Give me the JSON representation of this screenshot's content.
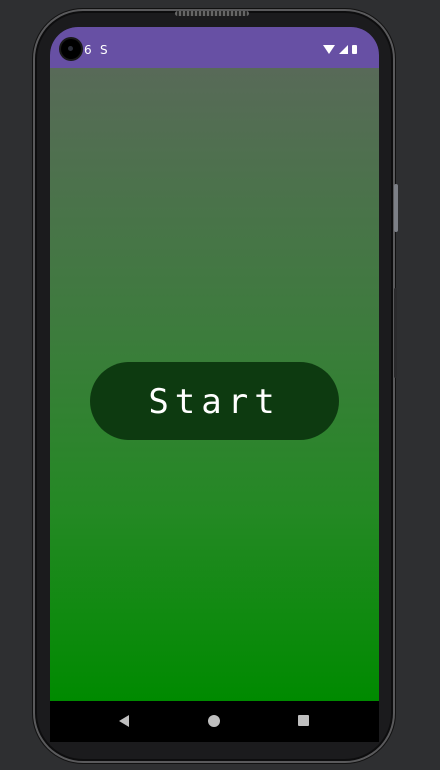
{
  "status_bar": {
    "left_items": [
      "6",
      "S"
    ],
    "background": "#6750a4"
  },
  "icons": {
    "camera": "front-camera-icon",
    "wifi": "wifi-icon",
    "signal": "cellular-signal-icon",
    "battery": "battery-icon",
    "back": "back-triangle-icon",
    "home": "home-circle-icon",
    "recents": "recents-square-icon"
  },
  "main": {
    "start_label": "Start",
    "gradient_top": "#586a58",
    "gradient_bottom": "#008a00",
    "button_color": "#0d3a10"
  }
}
